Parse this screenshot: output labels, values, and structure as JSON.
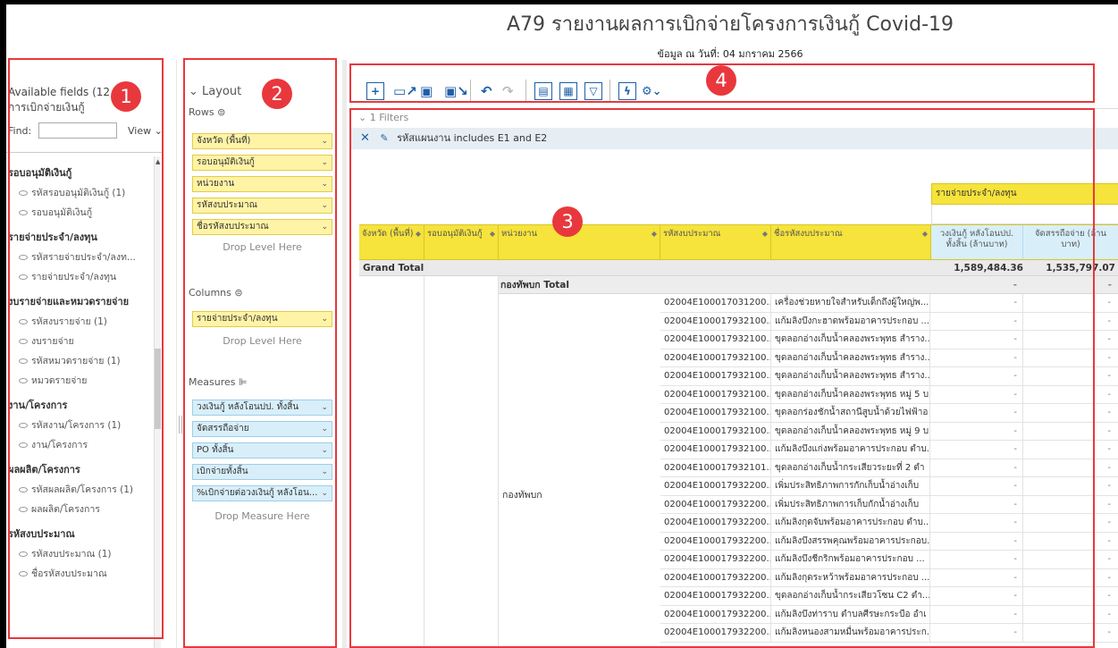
{
  "report": {
    "title": "A79 รายงานผลการเบิกจ่ายโครงการเงินกู้ Covid-19",
    "subtitle": "ข้อมูล ณ วันที่: 04 มกราคม 2566"
  },
  "badges": [
    "1",
    "2",
    "3",
    "4"
  ],
  "fields_panel": {
    "header": "Available fields (12",
    "header_sub": "การเบิกจ่ายเงินกู้",
    "find_label": "Find:",
    "find_value": "",
    "view_label": "View ⌄",
    "groups": [
      {
        "label": "รอบอนุมัติเงินกู้",
        "items": [
          "รหัสรอบอนุมัติเงินกู้ (1)",
          "รอบอนุมัติเงินกู้"
        ]
      },
      {
        "label": "รายจ่ายประจำ/ลงทุน",
        "items": [
          "รหัสรายจ่ายประจำ/ลงท...",
          "รายจ่ายประจำ/ลงทุน"
        ]
      },
      {
        "label": "งบรายจ่ายและหมวดรายจ่าย",
        "items": [
          "รหัสงบรายจ่าย (1)",
          "งบรายจ่าย",
          "รหัสหมวดรายจ่าย (1)",
          "หมวดรายจ่าย"
        ]
      },
      {
        "label": "งาน/โครงการ",
        "items": [
          "รหัสงาน/โครงการ (1)",
          "งาน/โครงการ"
        ]
      },
      {
        "label": "ผลผลิต/โครงการ",
        "items": [
          "รหัสผลผลิต/โครงการ (1)",
          "ผลผลิต/โครงการ"
        ]
      },
      {
        "label": "รหัสงบประมาณ",
        "items": [
          "รหัสงบประมาณ (1)",
          "ชื่อรหัสงบประมาณ"
        ]
      }
    ]
  },
  "layout_panel": {
    "title": "Layout",
    "rows_label": "Rows",
    "rows": [
      "จังหวัด (พื้นที่)",
      "รอบอนุมัติเงินกู้",
      "หน่วยงาน",
      "รหัสงบประมาณ",
      "ชื่อรหัสงบประมาณ"
    ],
    "drop_level": "Drop Level Here",
    "columns_label": "Columns",
    "columns": [
      "รายจ่ายประจำ/ลงทุน"
    ],
    "measures_label": "Measures",
    "measures": [
      "วงเงินกู้ หลังโอนปป. ทั้งสิ้น",
      "จัดสรรถือจ่าย",
      "PO ทั้งสิ้น",
      "เบิกจ่ายทั้งสิ้น",
      "%เบิกจ่ายต่อวงเงินกู้ หลังโอน..."
    ],
    "drop_measure": "Drop Measure Here"
  },
  "toolbar": {
    "icons": [
      "new-report-icon",
      "open-icon",
      "save-icon",
      "save-as-icon",
      "undo-icon",
      "redo-icon",
      "layout-panel-icon",
      "fields-panel-icon",
      "filter-icon",
      "auto-refresh-icon",
      "settings-icon"
    ]
  },
  "filters": {
    "label": "1 Filters",
    "active": "รหัสแผนงาน includes E1 and E2"
  },
  "grid": {
    "column_group": "รายจ่ายประจำ/ลงทุน",
    "headers": [
      "จังหวัด (พื้นที่)",
      "รอบอนุมัติเงินกู้",
      "หน่วยงาน",
      "รหัสงบประมาณ",
      "ชื่อรหัสงบประมาณ"
    ],
    "measure_headers": [
      "วงเงินกู้ หลังโอนปป. ทั้งสิ้น (ล้านบาท)",
      "จัดสรรถือจ่าย (ล้าน บาท)"
    ],
    "grand_total_label": "Grand Total",
    "grand_total_values": [
      "1,589,484.36",
      "1,535,797.07"
    ],
    "subtotal_label": "กองทัพบก Total",
    "subtotal_values": [
      "-",
      "-"
    ],
    "agency": "กองทัพบก",
    "rows": [
      {
        "code": "02004E100017031200...",
        "name": "เครื่องช่วยหายใจสำหรับเด็กถึงผู้ใหญ่พ...",
        "v1": "-",
        "v2": "-"
      },
      {
        "code": "02004E100017932100...",
        "name": "แก้มลิงบึงกะฮาดพร้อมอาคารประกอบ ...",
        "v1": "-",
        "v2": "-"
      },
      {
        "code": "02004E100017932100...",
        "name": "ขุดลอกอ่างเก็บน้ำคลองพระพุทธ สำราง...",
        "v1": "-",
        "v2": "-"
      },
      {
        "code": "02004E100017932100...",
        "name": "ขุดลอกอ่างเก็บน้ำคลองพระพุทธ สำราง...",
        "v1": "-",
        "v2": "-"
      },
      {
        "code": "02004E100017932100...",
        "name": "ขุดลอกอ่างเก็บน้ำคลองพระพุทธ สำราง...",
        "v1": "-",
        "v2": "-"
      },
      {
        "code": "02004E100017932100...",
        "name": "ขุดลอกอ่างเก็บน้ำคลองพระพุทธ หมู่ 5 บ",
        "v1": "-",
        "v2": "-"
      },
      {
        "code": "02004E100017932100...",
        "name": "ขุดลอกร่องชักน้ำสถานีสูบน้ำด้วยไฟฟ้าอ",
        "v1": "-",
        "v2": "-"
      },
      {
        "code": "02004E100017932100...",
        "name": "ขุดลอกอ่างเก็บน้ำคลองพระพุทธ หมู่ 9 บ",
        "v1": "-",
        "v2": "-"
      },
      {
        "code": "02004E100017932100...",
        "name": "แก้มลิงบึงแก่งพร้อมอาคารประกอบ ตำบ...",
        "v1": "-",
        "v2": "-"
      },
      {
        "code": "02004E100017932101...",
        "name": "ขุดลอกอ่างเก็บน้ำกระเสียวระยะที่ 2 ตำ",
        "v1": "-",
        "v2": "-"
      },
      {
        "code": "02004E100017932200...",
        "name": "เพิ่มประสิทธิภาพการกักเก็บน้ำอ่างเก็บ",
        "v1": "-",
        "v2": "-"
      },
      {
        "code": "02004E100017932200...",
        "name": "เพิ่มประสิทธิภาพการเก็บกักน้ำอ่างเก็บ",
        "v1": "-",
        "v2": "-"
      },
      {
        "code": "02004E100017932200...",
        "name": "แก้มลิงกุดจับพร้อมอาคารประกอบ ตำบ...",
        "v1": "-",
        "v2": "-"
      },
      {
        "code": "02004E100017932200...",
        "name": "แก้มลิงบึงสรรพคุณพร้อมอาคารประกอบ...",
        "v1": "-",
        "v2": "-"
      },
      {
        "code": "02004E100017932200...",
        "name": "แก้มลิงบึงชีกริกพร้อมอาคารประกอบ ...",
        "v1": "-",
        "v2": "-"
      },
      {
        "code": "02004E100017932200...",
        "name": "แก้มลิงกุดระหว้าพร้อมอาคารประกอบ ...",
        "v1": "-",
        "v2": "-"
      },
      {
        "code": "02004E100017932200...",
        "name": "ขุดลอกอ่างเก็บน้ำกระเสียวโซน C2 ตำ...",
        "v1": "-",
        "v2": "-"
      },
      {
        "code": "02004E100017932200...",
        "name": "แก้มลิงบึงท่าราบ ตำบลศีรษะกระบือ อำเ",
        "v1": "-",
        "v2": "-"
      },
      {
        "code": "02004E100017932200...",
        "name": "แก้มลิงหนองสามหมื่นพร้อมอาคารประก...",
        "v1": "-",
        "v2": "-"
      }
    ]
  },
  "colors": {
    "annotation": "#e8383d",
    "row_header": "#f6e33b",
    "measure": "#d8effa",
    "accent": "#1e5fa8"
  }
}
